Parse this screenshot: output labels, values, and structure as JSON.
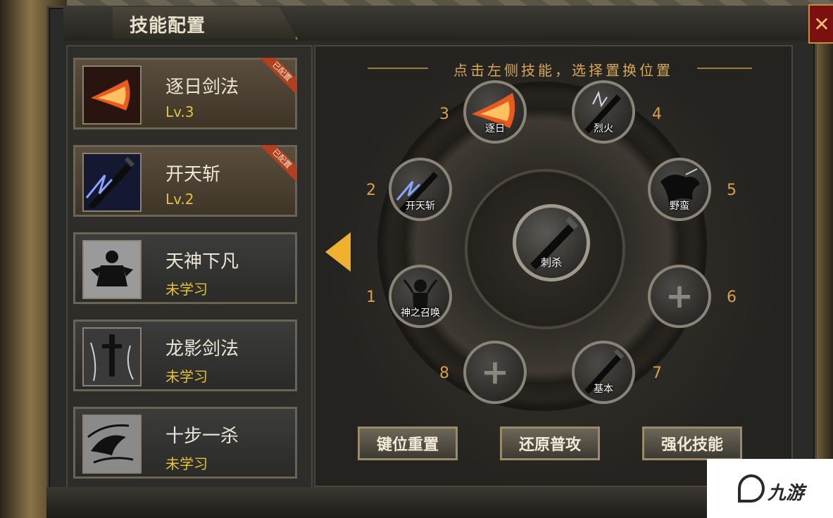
{
  "window": {
    "title": "技能配置",
    "close_label": "✕"
  },
  "skills": [
    {
      "name": "逐日剑法",
      "level": "Lv.3",
      "badge": "已配置",
      "icon": "fire-slash-icon",
      "status": "configured"
    },
    {
      "name": "开天斩",
      "level": "Lv.2",
      "badge": "已配置",
      "icon": "sword-lightning-icon",
      "status": "configured"
    },
    {
      "name": "天神下凡",
      "level": "未学习",
      "icon": "god-descend-icon",
      "status": "unlearned"
    },
    {
      "name": "龙影剑法",
      "level": "未学习",
      "icon": "dragon-shadow-sword-icon",
      "status": "unlearned"
    },
    {
      "name": "十步一杀",
      "level": "未学习",
      "icon": "ten-step-kill-icon",
      "status": "unlearned"
    }
  ],
  "wheel": {
    "hint": "点击左侧技能，选择置换位置",
    "center": {
      "label": "刺杀",
      "icon": "stab-sword-icon"
    },
    "slots": [
      {
        "number": "1",
        "label": "神之召唤",
        "icon": "summon-icon"
      },
      {
        "number": "2",
        "label": "开天斩",
        "icon": "sword-lightning-icon"
      },
      {
        "number": "3",
        "label": "逐日",
        "icon": "fire-slash-icon"
      },
      {
        "number": "4",
        "label": "烈火",
        "icon": "flame-sword-icon"
      },
      {
        "number": "5",
        "label": "野蛮",
        "icon": "charge-icon"
      },
      {
        "number": "6",
        "label": "+",
        "icon": "plus-icon"
      },
      {
        "number": "7",
        "label": "基本",
        "icon": "basic-sword-icon"
      },
      {
        "number": "8",
        "label": "+",
        "icon": "plus-icon"
      }
    ]
  },
  "buttons": {
    "reset_keys": "键位重置",
    "restore_attack": "还原普攻",
    "enhance_skill": "强化技能"
  },
  "watermark": {
    "text": "九游"
  },
  "colors": {
    "accent_gold": "#d6a04a",
    "level_yellow": "#e4c23c",
    "ribbon_red": "#b04020"
  }
}
